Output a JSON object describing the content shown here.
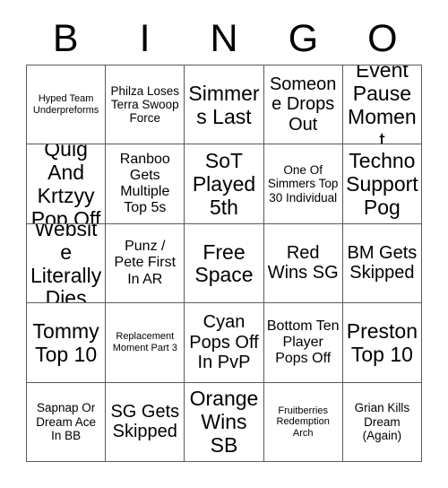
{
  "card": {
    "header_letters": [
      "B",
      "I",
      "N",
      "G",
      "O"
    ],
    "rows": [
      [
        {
          "text": "Hyped Team Underpreforms",
          "size": "fs-xs"
        },
        {
          "text": "Philza Loses Terra Swoop Force",
          "size": "fs-sm"
        },
        {
          "text": "Simmers Last",
          "size": "fs-xl"
        },
        {
          "text": "Someone Drops Out",
          "size": "fs-lg"
        },
        {
          "text": "Event Pause Moment",
          "size": "fs-xl"
        }
      ],
      [
        {
          "text": "Quig And Krtzyy Pop Off",
          "size": "fs-xl"
        },
        {
          "text": "Ranboo Gets Multiple Top 5s",
          "size": "fs-md"
        },
        {
          "text": "SoT Played 5th",
          "size": "fs-xl"
        },
        {
          "text": "One Of Simmers Top 30 Individual",
          "size": "fs-sm"
        },
        {
          "text": "Techno Support Pog",
          "size": "fs-xl"
        }
      ],
      [
        {
          "text": "Website Literally Dies",
          "size": "fs-xl"
        },
        {
          "text": "Punz / Pete First In AR",
          "size": "fs-md"
        },
        {
          "text": "Free Space",
          "size": "fs-xl"
        },
        {
          "text": "Red Wins SG",
          "size": "fs-lg"
        },
        {
          "text": "BM Gets Skipped",
          "size": "fs-lg"
        }
      ],
      [
        {
          "text": "Tommy Top 10",
          "size": "fs-xl"
        },
        {
          "text": "Replacement Moment Part 3",
          "size": "fs-xs"
        },
        {
          "text": "Cyan Pops Off In PvP",
          "size": "fs-lg"
        },
        {
          "text": "Bottom Ten Player Pops Off",
          "size": "fs-md"
        },
        {
          "text": "Preston Top 10",
          "size": "fs-xl"
        }
      ],
      [
        {
          "text": "Sapnap Or Dream Ace In BB",
          "size": "fs-sm"
        },
        {
          "text": "SG Gets Skipped",
          "size": "fs-lg"
        },
        {
          "text": "Orange Wins SB",
          "size": "fs-xl"
        },
        {
          "text": "Fruitberries Redemption Arch",
          "size": "fs-xs"
        },
        {
          "text": "Grian Kills Dream (Again)",
          "size": "fs-sm"
        }
      ]
    ]
  },
  "colors": {
    "background": "#ffffff",
    "text": "#000000",
    "grid_line": "#5a5a5a"
  }
}
